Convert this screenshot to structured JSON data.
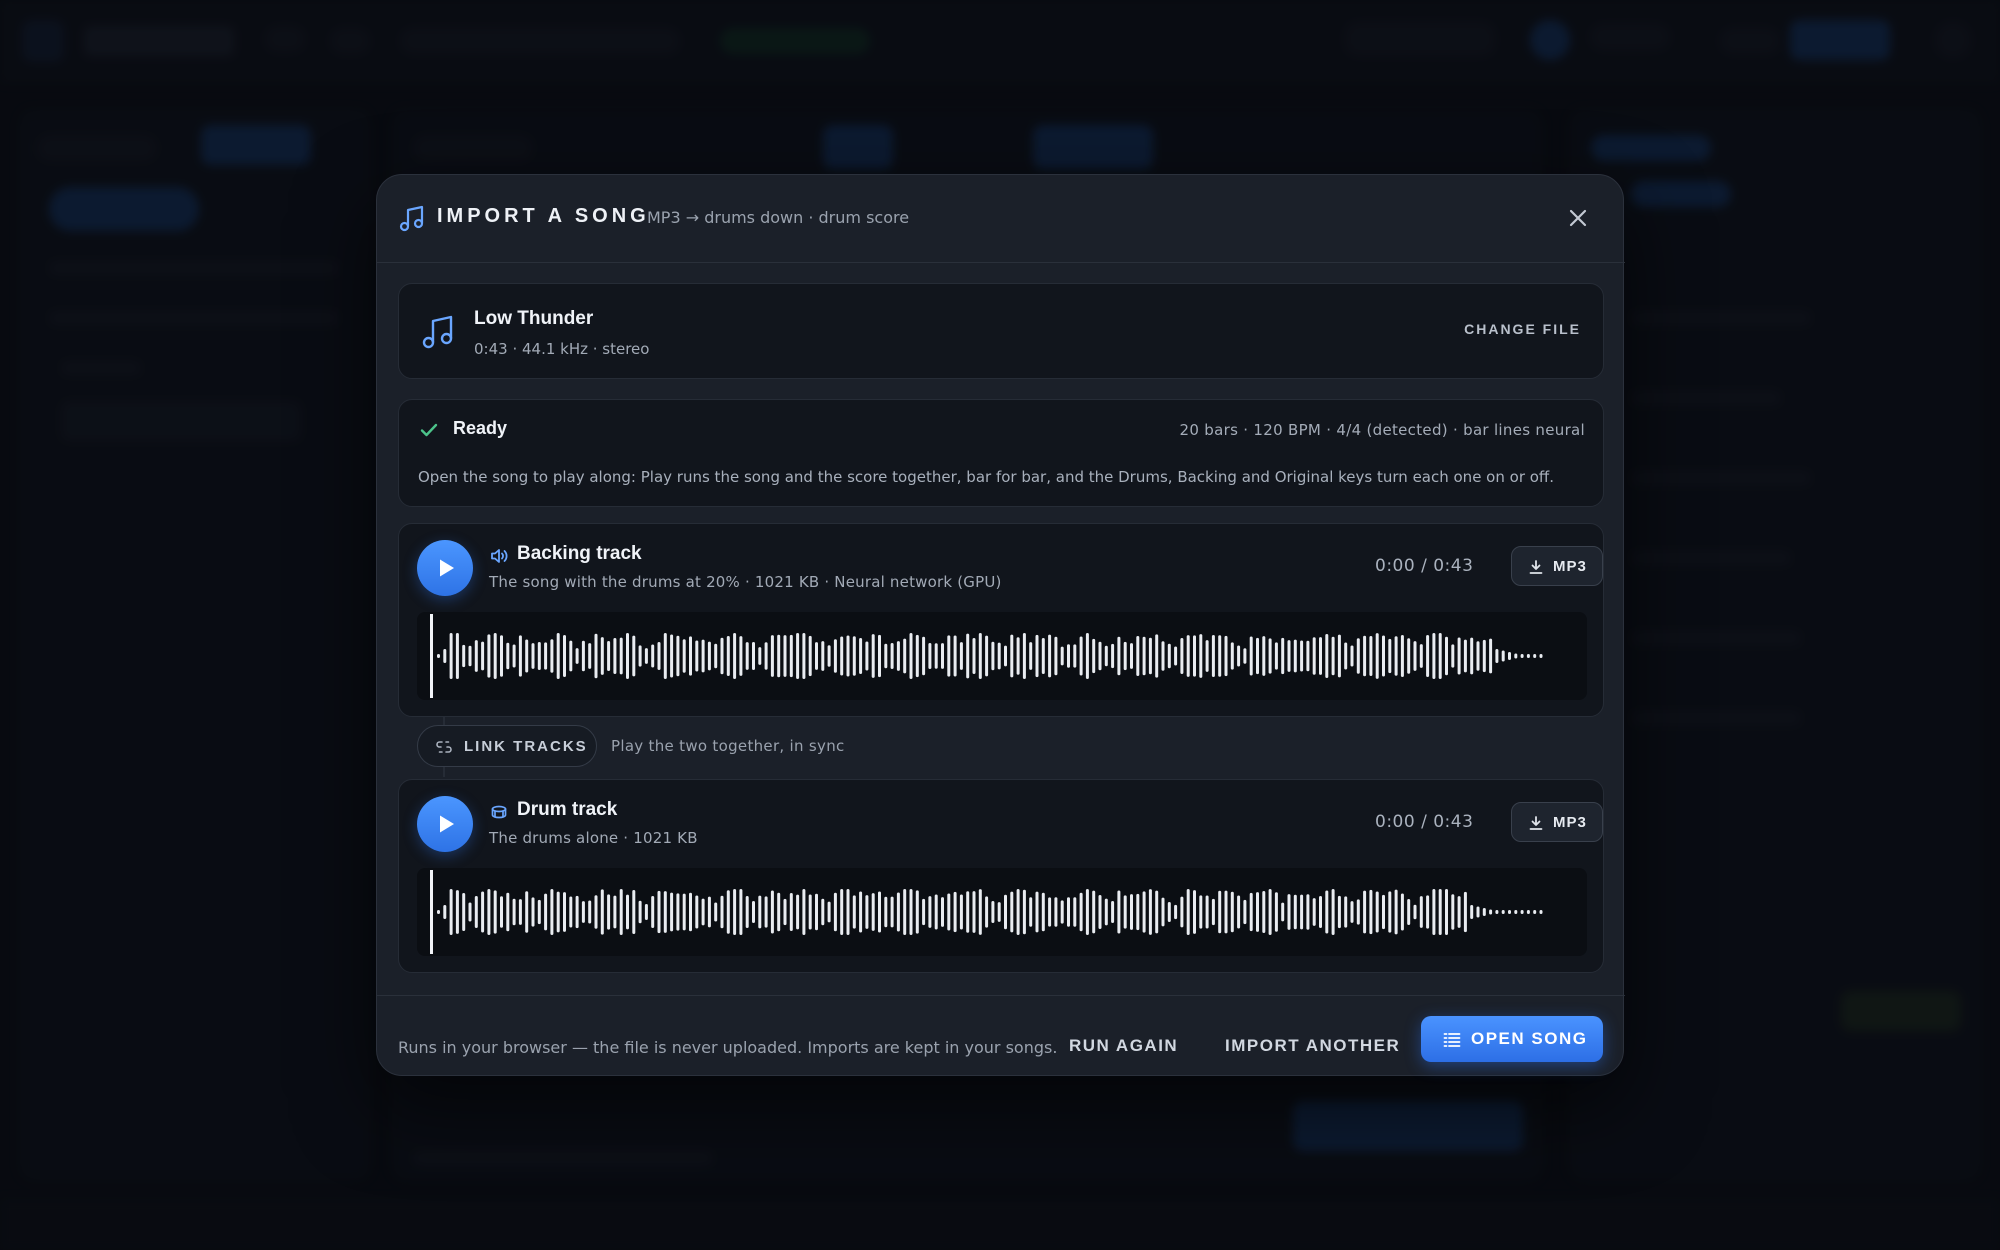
{
  "modal": {
    "title": "IMPORT A SONG",
    "subtitle": "MP3 → drums down · drum score",
    "icon": "music-note-icon",
    "close_icon": "close-icon"
  },
  "file": {
    "name": "Low Thunder",
    "meta": "0:43 · 44.1 kHz · stereo",
    "change_label": "CHANGE FILE"
  },
  "status": {
    "label": "Ready",
    "info": "20 bars · 120 BPM · 4/4 (detected) · bar lines neural",
    "description": "Open the song to play along: Play runs the song and the score together, bar for bar, and the Drums, Backing and Original keys turn each one on or off."
  },
  "backing": {
    "title": "Backing track",
    "meta": "The song with the drums at 20% · 1021 KB · Neural network (GPU)",
    "time": "0:00 / 0:43",
    "download_label": "MP3",
    "icon": "speaker-icon"
  },
  "link": {
    "label": "LINK TRACKS",
    "hint": "Play the two together, in sync",
    "icon": "link-icon"
  },
  "drum": {
    "title": "Drum track",
    "meta": "The drums alone · 1021 KB",
    "time": "0:00 / 0:43",
    "download_label": "MP3",
    "icon": "drum-icon"
  },
  "footer": {
    "note": "Runs in your browser — the file is never uploaded. Imports are kept in your songs.",
    "run_again": "RUN AGAIN",
    "import_another": "IMPORT ANOTHER",
    "open_song": "OPEN SONG"
  },
  "colors": {
    "accent": "#3d84f5",
    "success": "#4cc38a",
    "icon_accent": "#6aa6ff",
    "waveform": "#e9ecf1"
  }
}
